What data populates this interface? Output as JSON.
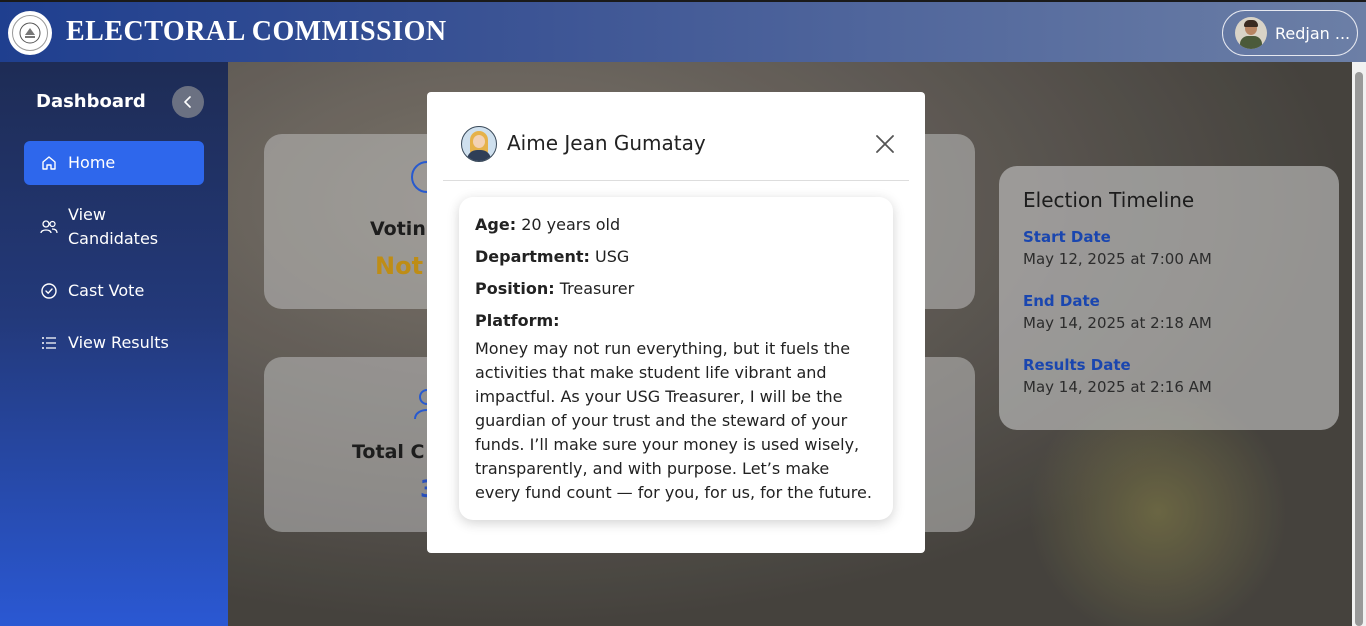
{
  "header": {
    "brand": "ELECTORAL COMMISSION",
    "logo_text": "ELECTORAL COMMISSION",
    "user_name": "Redjan ..."
  },
  "sidebar": {
    "title": "Dashboard",
    "items": [
      {
        "label": "Home",
        "icon": "home-icon",
        "active": true
      },
      {
        "label": "View Candidates",
        "icon": "users-icon",
        "active": false
      },
      {
        "label": "Cast Vote",
        "icon": "check-circle-icon",
        "active": false
      },
      {
        "label": "View Results",
        "icon": "list-icon",
        "active": false
      }
    ]
  },
  "background_cards": {
    "voting_status_label": "Votin",
    "voting_status_value": "Not V",
    "total_label": "Total C",
    "total_value": "3"
  },
  "timeline": {
    "title": "Election Timeline",
    "start_label": "Start Date",
    "start_value": "May 12, 2025 at 7:00 AM",
    "end_label": "End Date",
    "end_value": "May 14, 2025 at 2:18 AM",
    "results_label": "Results Date",
    "results_value": "May 14, 2025 at 2:16 AM"
  },
  "modal": {
    "name": "Aime Jean Gumatay",
    "age_label": "Age:",
    "age_value": "20 years old",
    "department_label": "Department:",
    "department_value": "USG",
    "position_label": "Position:",
    "position_value": "Treasurer",
    "platform_label": "Platform:",
    "platform_text": "Money may not run everything, but it fuels the activities that make student life vibrant and impactful. As your USG Treasurer, I will be the guardian of your trust and the steward of your funds. I’ll make sure your money is used wisely, transparently, and with purpose. Let’s make every fund count — for you, for us, for the future."
  },
  "colors": {
    "active_nav": "#2e67ec",
    "accent_blue": "#1e50c8",
    "status_amber": "#d9a11a"
  }
}
